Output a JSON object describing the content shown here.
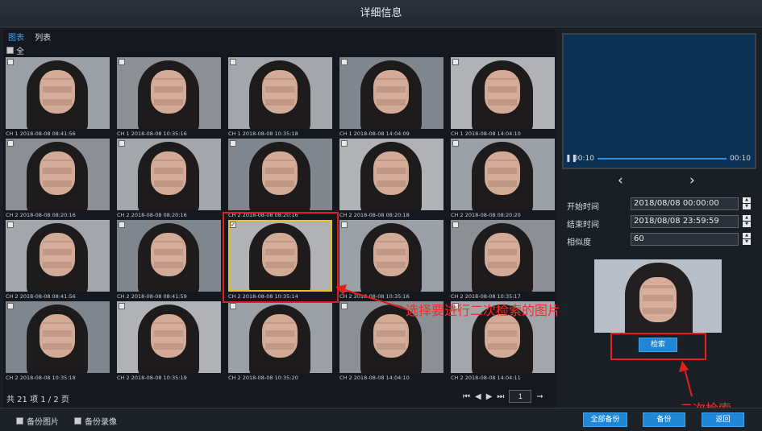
{
  "window": {
    "title": "详细信息"
  },
  "tabs": [
    {
      "label": "图表",
      "active": true
    },
    {
      "label": "列表",
      "active": false
    }
  ],
  "select_all_label": "全",
  "grid": [
    {
      "caption": "CH 1 2018-08-08 08:41:56",
      "checked": false
    },
    {
      "caption": "CH 1 2018-08-08 10:35:16",
      "checked": false
    },
    {
      "caption": "CH 1 2018-08-08 10:35:18",
      "checked": false
    },
    {
      "caption": "CH 1 2018-08-08 14:04:09",
      "checked": false
    },
    {
      "caption": "CH 1 2018-08-08 14:04:10",
      "checked": false
    },
    {
      "caption": "CH 2 2018-08-08 08:20:16",
      "checked": false
    },
    {
      "caption": "CH 2 2018-08-08 08:20:16",
      "checked": false
    },
    {
      "caption": "CH 2 2018-08-08 08:20:16",
      "checked": false
    },
    {
      "caption": "CH 2 2018-08-08 08:20:18",
      "checked": false
    },
    {
      "caption": "CH 2 2018-08-08 08:20:20",
      "checked": false
    },
    {
      "caption": "CH 2 2018-08-08 08:41:56",
      "checked": false
    },
    {
      "caption": "CH 2 2018-08-08 08:41:59",
      "checked": false
    },
    {
      "caption": "CH 2 2018-08-08 10:35:14",
      "checked": true
    },
    {
      "caption": "CH 2 2018-08-08 10:35:16",
      "checked": false
    },
    {
      "caption": "CH 2 2018-08-08 10:35:17",
      "checked": false
    },
    {
      "caption": "CH 2 2018-08-08 10:35:18",
      "checked": false
    },
    {
      "caption": "CH 2 2018-08-08 10:35:19",
      "checked": false
    },
    {
      "caption": "CH 2 2018-08-08 10:35:20",
      "checked": false
    },
    {
      "caption": "CH 2 2018-08-08 14:04:10",
      "checked": false
    },
    {
      "caption": "CH 2 2018-08-08 14:04:11",
      "checked": false
    }
  ],
  "pagination": {
    "text": "共 21 项 1 / 2 页",
    "page_input": "1"
  },
  "player": {
    "time_left": "00:10",
    "time_right": "00:10"
  },
  "form": {
    "start_label": "开始时间",
    "start_value": "2018/08/08 00:00:00",
    "end_label": "结束时间",
    "end_value": "2018/08/08 23:59:59",
    "sim_label": "相似度",
    "sim_value": "60"
  },
  "search_button": "检索",
  "annotations": {
    "select_text": "选择要进行二次检索的图片",
    "search_text": "二次检索"
  },
  "bottom": {
    "backup_images": "备份图片",
    "backup_video": "备份录像",
    "backup_all": "全部备份",
    "backup": "备份",
    "back": "返回"
  },
  "colors": {
    "accent": "#1f87d6",
    "selection": "#e7c21b",
    "annotation": "#e21f1f"
  }
}
